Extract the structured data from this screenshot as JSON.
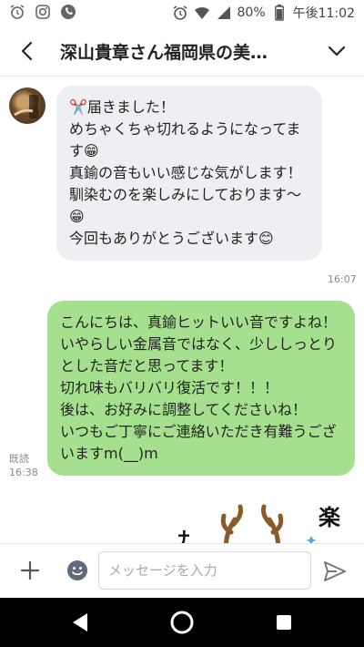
{
  "status_bar": {
    "battery": "80%",
    "clock": "午後11:02"
  },
  "header": {
    "title": "深山貴章さん福岡県の美…"
  },
  "messages": {
    "incoming": {
      "line1": "届きました！",
      "line2": "めちゃくちゃ切れるようになってます",
      "line3": "真鍮の音もいい感じな気がします！",
      "line4": "馴染むのを楽しみにしております〜",
      "line5": "今回もありがとうございます",
      "time": "16:07"
    },
    "outgoing": {
      "text": "こんにちは、真鍮ヒットいい音ですよね！\nいやらしい金属音ではなく、少ししっとりとした音だと思ってます！\n切れ味もバリバリ復活です！！！\n後は、お好みに調整してくださいね！\nいつもご丁寧にご連絡いただき有難うございますm(__)m",
      "read_label": "既読",
      "time": "16:38"
    },
    "sticker_text": {
      "left": "サロ",
      "right": "楽"
    }
  },
  "input_bar": {
    "placeholder": "メッセージを入力"
  },
  "colors": {
    "incoming_bubble": "#eeeff2",
    "outgoing_bubble": "#a5e08e",
    "nav_bar": "#000000"
  }
}
